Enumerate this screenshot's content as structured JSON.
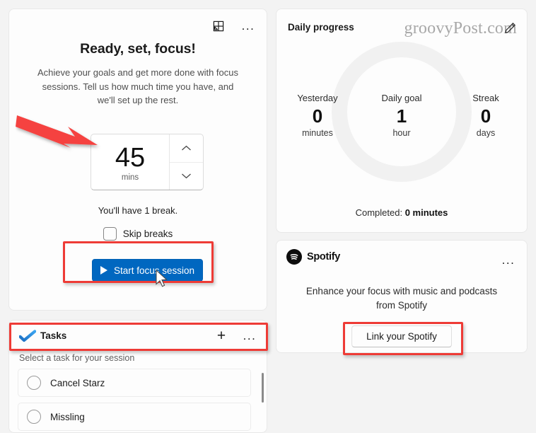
{
  "theme": {
    "accent": "#0067c0",
    "page_bg": "#f3f3f3",
    "card_bg": "#fdfdfd",
    "annotation_red": "#ee3b36",
    "ring_track": "#f1f1f1"
  },
  "focus_card": {
    "title": "Ready, set, focus!",
    "description": "Achieve your goals and get more done with focus sessions. Tell us how much time you have, and we'll set up the rest.",
    "popout_icon": "pop-out-icon",
    "more_icon": "more-options-icon",
    "more_label": "...",
    "timer": {
      "value": "45",
      "unit": "mins",
      "increase_icon": "chevron-up-icon",
      "decrease_icon": "chevron-down-icon"
    },
    "break_note": "You'll have 1 break.",
    "skip_breaks_label": "Skip breaks",
    "skip_breaks_checked": false,
    "start_button_label": "Start focus session",
    "start_button_icon": "play-icon"
  },
  "tasks_card": {
    "title": "Tasks",
    "brand_icon": "todo-check-icon",
    "add_icon": "plus-icon",
    "add_label": "+",
    "more_icon": "more-options-icon",
    "more_label": "...",
    "subtitle": "Select a task for your session",
    "items": [
      {
        "label": "Cancel Starz",
        "completed": false
      },
      {
        "label": "Missling",
        "completed": false
      }
    ]
  },
  "progress_card": {
    "title": "Daily progress",
    "edit_icon": "pencil-edit-icon",
    "watermark": "groovyPost.com",
    "stats": [
      {
        "label": "Yesterday",
        "value": "0",
        "unit": "minutes"
      },
      {
        "label": "Daily goal",
        "value": "1",
        "unit": "hour"
      },
      {
        "label": "Streak",
        "value": "0",
        "unit": "days"
      }
    ],
    "completed_prefix": "Completed: ",
    "completed_value": "0 minutes",
    "ring_progress_percent": 0
  },
  "spotify_card": {
    "brand_name": "Spotify",
    "brand_icon": "spotify-logo-icon",
    "more_icon": "more-options-icon",
    "more_label": "...",
    "description": "Enhance your focus with music and podcasts from Spotify",
    "link_button_label": "Link your Spotify"
  },
  "annotations": {
    "arrow_target": "timer-value",
    "boxed_elements": [
      "start-focus-session-button",
      "tasks-header",
      "link-your-spotify-button"
    ]
  }
}
